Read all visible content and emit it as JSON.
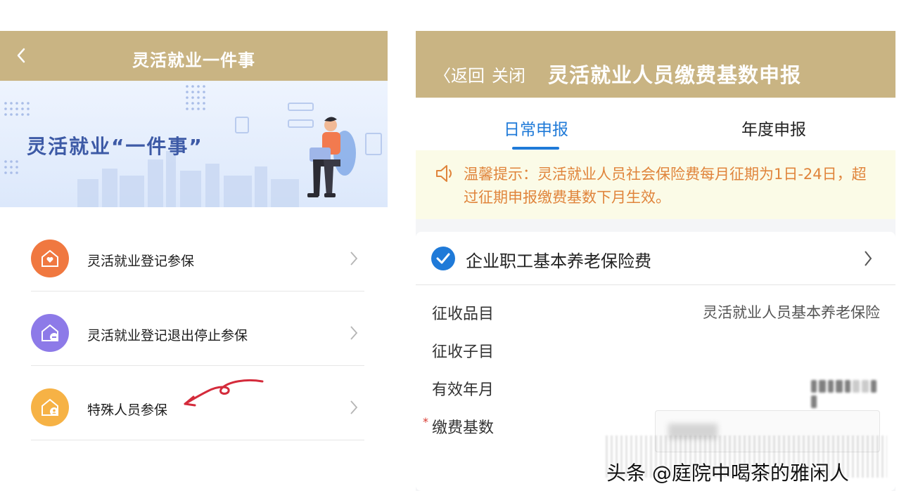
{
  "left": {
    "header": {
      "title": "灵活就业一件事"
    },
    "banner": {
      "text": "灵活就业“一件事”"
    },
    "menu": [
      {
        "label": "灵活就业登记参保",
        "icon_color": "#f07840"
      },
      {
        "label": "灵活就业登记退出停止参保",
        "icon_color": "#8d7ae8"
      },
      {
        "label": "特殊人员参保",
        "icon_color": "#f6b245"
      }
    ]
  },
  "right": {
    "header": {
      "back": "〈返回",
      "close": "关闭",
      "title": "灵活就业人员缴费基数申报"
    },
    "tabs": [
      {
        "label": "日常申报",
        "active": true
      },
      {
        "label": "年度申报",
        "active": false
      }
    ],
    "notice": {
      "text": "温馨提示：灵活就业人员社会保险费每月征期为1日-24日，超过征期申报缴费基数下月生效。"
    },
    "card": {
      "title": "企业职工基本养老保险费",
      "rows": [
        {
          "label": "征收品目",
          "value": "灵活就业人员基本养老保险"
        },
        {
          "label": "征收子目",
          "value": ""
        },
        {
          "label": "有效年月",
          "value": ""
        },
        {
          "label": "缴费基数",
          "value": "",
          "required": true
        }
      ]
    }
  },
  "watermark": "头条 @庭院中喝茶的雅闲人",
  "colors": {
    "header_gold": "#c9b483",
    "accent_blue": "#1f7ad8",
    "notice_orange": "#e0843b"
  }
}
